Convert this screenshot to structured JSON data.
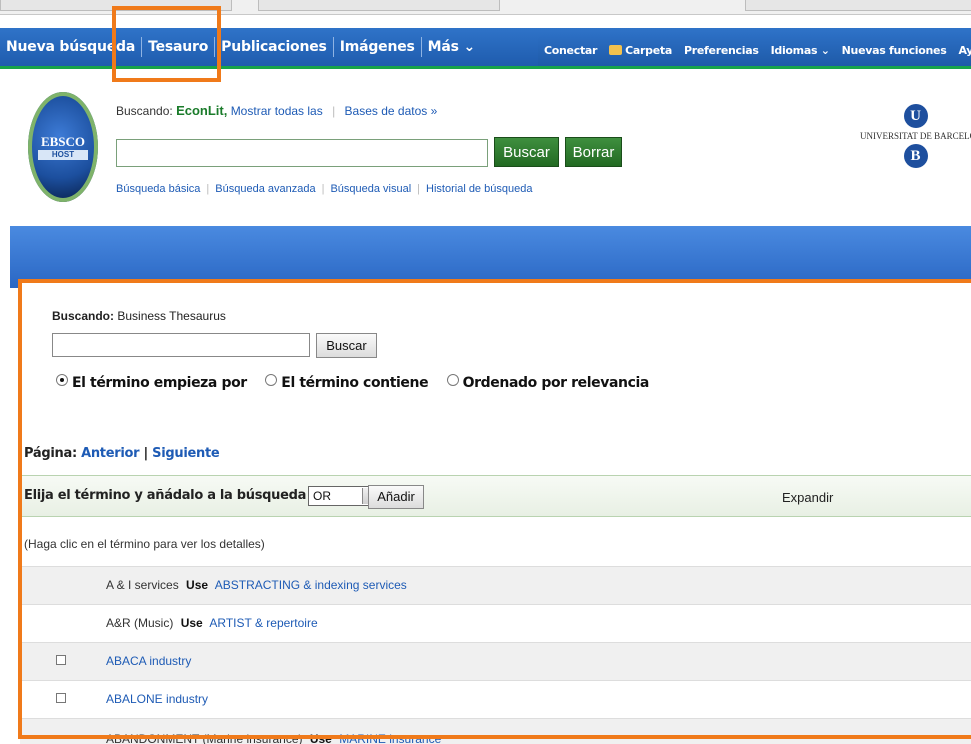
{
  "nav": {
    "left_items": [
      "Nueva búsqueda",
      "Tesauro",
      "Publicaciones",
      "Imágenes",
      "Más ⌄"
    ],
    "right_items": [
      "Conectar",
      "Carpeta",
      "Preferencias",
      "Idiomas ⌄",
      "Nuevas funciones",
      "Ayuda"
    ]
  },
  "header": {
    "logo_text": "EBSCO",
    "logo_sub": "HOST",
    "searching_label": "Buscando:",
    "database": "EconLit,",
    "show_all": "Mostrar todas las",
    "databases_link": "Bases de datos »",
    "search_value": "",
    "search_button": "Buscar",
    "clear_button": "Borrar",
    "links": [
      "Búsqueda básica",
      "Búsqueda avanzada",
      "Búsqueda visual",
      "Historial de búsqueda"
    ],
    "univ_letter_top": "U",
    "univ_name": "UNIVERSITAT DE BARCELONA",
    "univ_letter_bottom": "B"
  },
  "thesaurus": {
    "searching_label": "Buscando:",
    "source": "Business Thesaurus",
    "input_value": "",
    "search_button": "Buscar",
    "radios": [
      {
        "label": "El término empieza por",
        "checked": true
      },
      {
        "label": "El término contiene",
        "checked": false
      },
      {
        "label": "Ordenado por relevancia",
        "checked": false
      }
    ],
    "page_label": "Página:",
    "prev": "Anterior",
    "page_sep": "|",
    "next": "Siguiente",
    "choose_label": "Elija el término y añádalo a la búsqueda con:",
    "operator": "OR",
    "add_button": "Añadir",
    "expand_label": "Expandir",
    "hint": "(Haga clic en el término para ver los detalles)",
    "terms": [
      {
        "term": "A & I services",
        "use": "Use",
        "target": "ABSTRACTING & indexing services",
        "checkbox": false
      },
      {
        "term": "A&R (Music)",
        "use": "Use",
        "target": "ARTIST & repertoire",
        "checkbox": false
      },
      {
        "term": "",
        "use": "",
        "target": "ABACA industry",
        "checkbox": true
      },
      {
        "term": "",
        "use": "",
        "target": "ABALONE industry",
        "checkbox": true
      },
      {
        "term": "ABANDONMENT (Marine insurance)",
        "use": "Use",
        "target": "MARINE insurance",
        "checkbox": false
      }
    ]
  },
  "colors": {
    "highlight": "#f07a1a",
    "nav_blue": "#1f5cae",
    "green": "#226a22",
    "link": "#1e5bb5"
  }
}
